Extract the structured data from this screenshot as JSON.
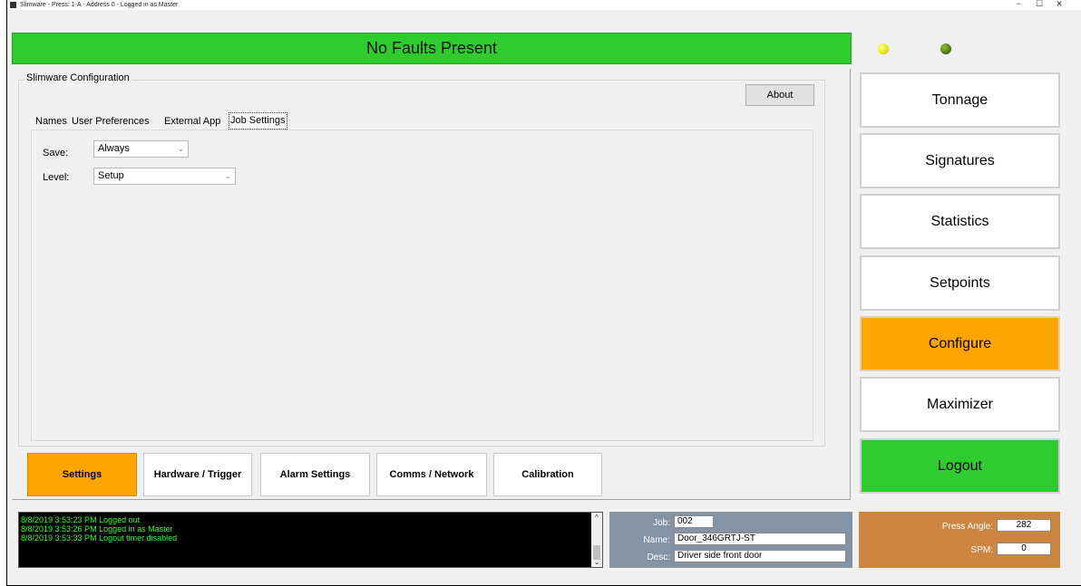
{
  "window": {
    "title": "Slimware - Press: 1-A - Address 0 - Logged in as Master",
    "minimize": "−",
    "maximize": "☐",
    "close": "✕"
  },
  "banner": {
    "text": "No Faults Present",
    "color": "#2ecc2e"
  },
  "indicators": {
    "led1_color": "#e6e600",
    "led2_color": "#4f7a12"
  },
  "config": {
    "group_label": "Slimware Configuration",
    "about_label": "About",
    "tabs": [
      {
        "label": "Names"
      },
      {
        "label": "User Preferences"
      },
      {
        "label": "External App"
      },
      {
        "label": "Job Settings",
        "active": true
      }
    ],
    "save_label": "Save:",
    "save_value": "Always",
    "level_label": "Level:",
    "level_value": "Setup"
  },
  "bottom_tabs": [
    {
      "label": "Settings",
      "active": true
    },
    {
      "label": "Hardware / Trigger"
    },
    {
      "label": "Alarm Settings"
    },
    {
      "label": "Comms / Network"
    },
    {
      "label": "Calibration"
    }
  ],
  "side_nav": [
    {
      "label": "Tonnage"
    },
    {
      "label": "Signatures"
    },
    {
      "label": "Statistics"
    },
    {
      "label": "Setpoints"
    },
    {
      "label": "Configure",
      "active": true
    },
    {
      "label": "Maximizer"
    },
    {
      "label": "Logout"
    }
  ],
  "log": [
    "8/8/2019 3:53:23 PM  Logged out",
    "8/8/2019 3:53:26 PM  Logged in as Master",
    "8/8/2019 3:53:33 PM  Logout timer disabled"
  ],
  "job": {
    "job_label": "Job:",
    "job_value": "002",
    "name_label": "Name:",
    "name_value": "Door_346GRTJ-ST",
    "desc_label": "Desc:",
    "desc_value": "Driver side front door"
  },
  "press": {
    "angle_label": "Press Angle:",
    "angle_value": "282",
    "spm_label": "SPM:",
    "spm_value": "0"
  },
  "colors": {
    "active": "#ffa500",
    "ok": "#2ecc2e",
    "job_panel": "#8494a6",
    "press_panel": "#cd853f",
    "log_text": "#2bff2b"
  }
}
